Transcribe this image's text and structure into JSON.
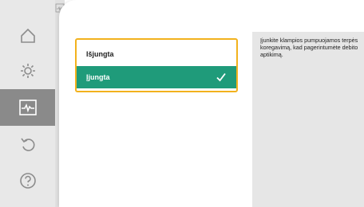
{
  "sidebar": {
    "items": [
      {
        "icon": "home-icon"
      },
      {
        "icon": "gear-icon"
      },
      {
        "icon": "diagnostics-icon",
        "active": true
      },
      {
        "icon": "undo-icon"
      },
      {
        "icon": "help-icon"
      }
    ]
  },
  "options": [
    {
      "label": "Išjungta",
      "selected": false
    },
    {
      "label": "Įjungta",
      "selected": true
    }
  ],
  "info": {
    "text": "Įjunkite klampios pumpuojamos terpės koregavimą, kad pagerintumėte debito aptikimą."
  },
  "colors": {
    "accent": "#1f9b7a",
    "focus": "#f2b21d",
    "sidebar": "#e8e8e8",
    "sidebar_active": "#8a8a8a"
  }
}
